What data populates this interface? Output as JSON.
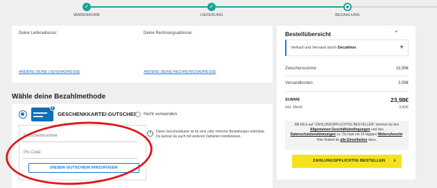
{
  "stepper": {
    "steps": [
      {
        "label": "WARENKORB",
        "status": "done"
      },
      {
        "label": "LIEFERUNG",
        "status": "done"
      },
      {
        "label": "BEZAHLUNG",
        "status": "current"
      }
    ],
    "check_glyph": "✓",
    "accent": "#17a398"
  },
  "addresses": {
    "delivery_label": "Deine Lieferadresse:",
    "billing_label": "Deine Rechnungsadresse:",
    "change_delivery": "ANDERE DEINE LIEFERADRESSE",
    "change_billing": "ANDERE DEINE RECHNUNGSADRESSE"
  },
  "payment": {
    "heading": "Wähle deine Bezahlmethode",
    "method_title": "GESCHENKKARTE/-GUTSCHEIN",
    "badge": "€",
    "not_use_label": "Nicht verwenden",
    "voucher_number_placeholder": "Gutscheinnummer",
    "pin_placeholder": "Pin Code",
    "add_button": "DIESEN GUTSCHEIN HINZUFÜGEN",
    "info_icon": "i",
    "info_text": "Deine Geschenkkarte ist für eine oder mehrere Bestellungen einlösbar. Du kannst sie auch mit anderen Zahlarten kombinieren."
  },
  "summary": {
    "title": "Bestellübersicht",
    "dot": "•",
    "seller_prefix": "Verkauf und Versand durch",
    "seller_name": "Decathlon",
    "plus": "+",
    "subtotal_label": "Zwischensumme",
    "subtotal_value": "19,99€",
    "shipping_label": "Versandkosten",
    "shipping_value": "3,99€",
    "total_label": "SUMME",
    "total_value": "23,98€",
    "vat_label": "inkl. MwSt",
    "vat_value": "3,83€",
    "legal_1": "Mit Klick auf \"ZAHLUNGSPFLICHTIG BESTELLEN\" stimmst du den",
    "legal_terms": "Allgemeinen Geschäftsbedingungen",
    "legal_2": "und den",
    "legal_privacy": "Datenschutzbestimmungen",
    "legal_3": "zu. Du hast ein 14 tägiges",
    "legal_withdrawal": "Widerrufsrecht",
    "legal_4": ". Hier findest du",
    "legal_details": "alle Einzelheiten",
    "legal_5": "dazu.",
    "checkout_button": "ZAHLUNGSPFLICHTIG BESTELLEN",
    "checkout_chevron": "›",
    "checkout_color": "#f4e31b"
  },
  "annotation_color": "#e0161b"
}
